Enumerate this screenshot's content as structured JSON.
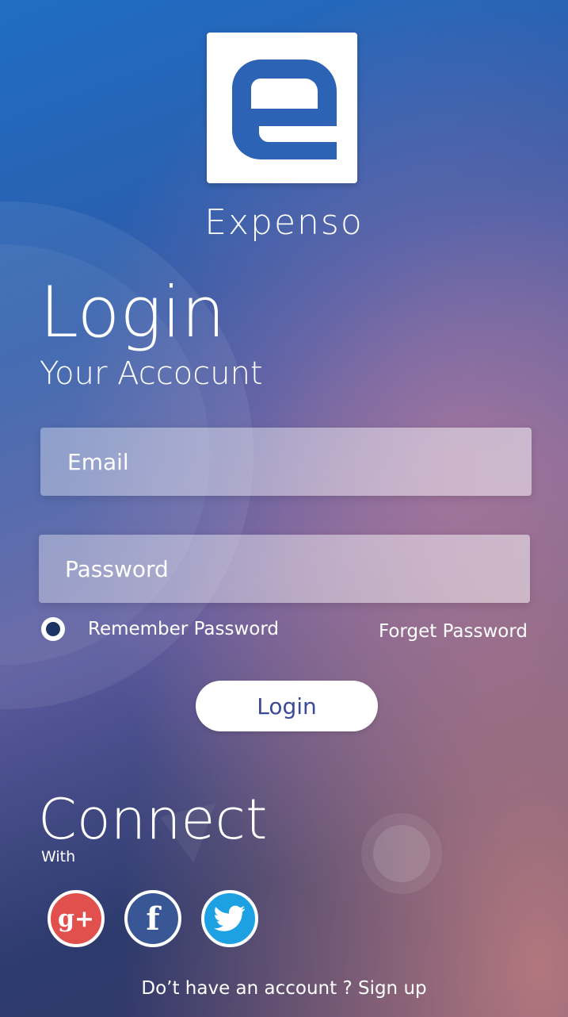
{
  "app": {
    "name": "Expenso",
    "logo_letter": "e"
  },
  "login": {
    "title": "Login",
    "subtitle": "Your Accocunt",
    "email_placeholder": "Email",
    "password_placeholder": "Password",
    "remember_label": "Remember Password",
    "forgot_label": "Forget Password",
    "button_label": "Login"
  },
  "connect": {
    "title": "Connect",
    "subtitle": "With",
    "providers": [
      {
        "name": "google-plus",
        "glyph": "g+",
        "color": "#e2504e"
      },
      {
        "name": "facebook",
        "glyph": "f",
        "color": "#3a5795"
      },
      {
        "name": "twitter",
        "glyph": "bird",
        "color": "#1da1e2"
      }
    ]
  },
  "footer": {
    "prompt": "Do’t have an account ? ",
    "signup_label": "Sign up"
  },
  "colors": {
    "brand_blue": "#2d63b4",
    "button_text": "#3b4a98",
    "radio_fill": "#1b3462"
  }
}
